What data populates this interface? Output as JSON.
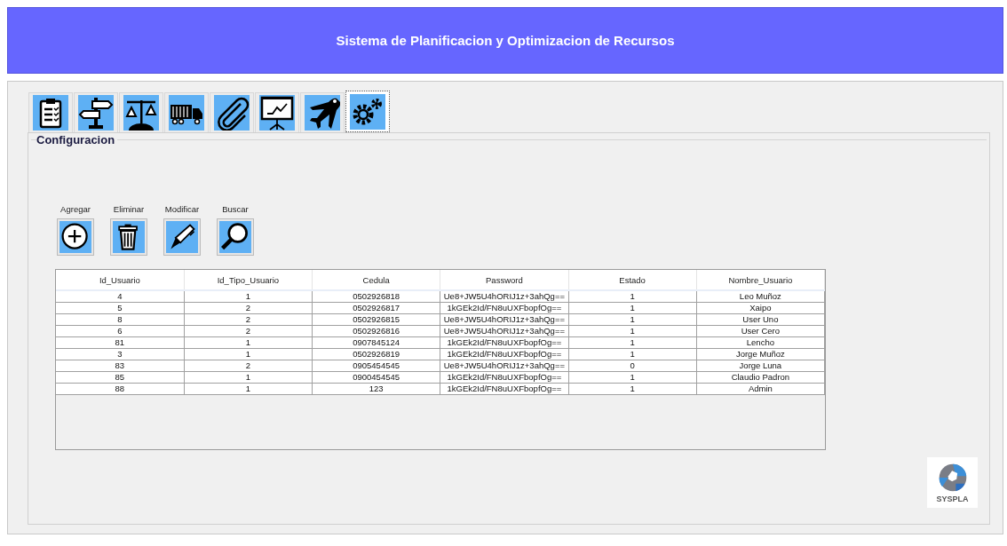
{
  "window": {
    "title": "Sistema de Planificacion y Optimizacion de Recursos"
  },
  "tabs": [
    {
      "selected": false
    },
    {
      "selected": false
    },
    {
      "selected": false
    },
    {
      "selected": false
    },
    {
      "selected": false
    },
    {
      "selected": false
    },
    {
      "selected": false
    },
    {
      "selected": true
    }
  ],
  "panel": {
    "title": "Configuracion"
  },
  "actions": [
    {
      "label": "Agregar"
    },
    {
      "label": "Eliminar"
    },
    {
      "label": "Modificar"
    },
    {
      "label": "Buscar"
    }
  ],
  "table": {
    "columns": [
      "Id_Usuario",
      "Id_Tipo_Usuario",
      "Cedula",
      "Password",
      "Estado",
      "Nombre_Usuario"
    ],
    "rows": [
      [
        "4",
        "1",
        "0502926818",
        "Ue8+JW5U4hORIJ1z+3ahQg==",
        "1",
        "Leo Muñoz"
      ],
      [
        "5",
        "2",
        "0502926817",
        "1kGEk2Id/FN8uUXFbopfOg==",
        "1",
        "Xaipo"
      ],
      [
        "8",
        "2",
        "0502926815",
        "Ue8+JW5U4hORIJ1z+3ahQg==",
        "1",
        "User Uno"
      ],
      [
        "6",
        "2",
        "0502926816",
        "Ue8+JW5U4hORIJ1z+3ahQg==",
        "1",
        "User Cero"
      ],
      [
        "81",
        "1",
        "0907845124",
        "1kGEk2Id/FN8uUXFbopfOg==",
        "1",
        "Lencho"
      ],
      [
        "3",
        "1",
        "0502926819",
        "1kGEk2Id/FN8uUXFbopfOg==",
        "1",
        "Jorge Muñoz"
      ],
      [
        "83",
        "2",
        "0905454545",
        "Ue8+JW5U4hORIJ1z+3ahQg==",
        "0",
        "Jorge Luna"
      ],
      [
        "85",
        "1",
        "0900454545",
        "1kGEk2Id/FN8uUXFbopfOg==",
        "1",
        "Claudio Padron"
      ],
      [
        "88",
        "1",
        "123",
        "1kGEk2Id/FN8uUXFbopfOg==",
        "1",
        "Admin"
      ]
    ]
  },
  "logo": {
    "text": "SYSPLA"
  }
}
